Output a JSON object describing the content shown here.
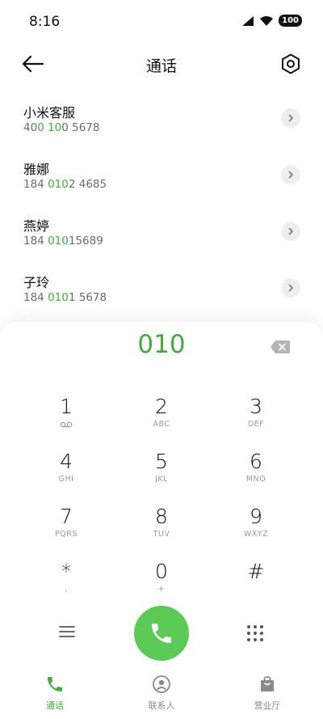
{
  "status": {
    "time": "8:16",
    "battery": "100"
  },
  "header": {
    "title": "通话"
  },
  "contacts": [
    {
      "name": "小米客服",
      "number_pre": "40",
      "number_hl": "0 10",
      "number_post": "0 5678"
    },
    {
      "name": "雅娜",
      "number_pre": "184 ",
      "number_hl": "010",
      "number_post": "2 4685"
    },
    {
      "name": "燕婷",
      "number_pre": "184 ",
      "number_hl": "010",
      "number_post": "15689"
    },
    {
      "name": "子玲",
      "number_pre": "184 ",
      "number_hl": "010",
      "number_post": "1 5678"
    }
  ],
  "dialer": {
    "input": "010",
    "keys": [
      {
        "digit": "1",
        "letters": ""
      },
      {
        "digit": "2",
        "letters": "ABC"
      },
      {
        "digit": "3",
        "letters": "DEF"
      },
      {
        "digit": "4",
        "letters": "GHI"
      },
      {
        "digit": "5",
        "letters": "JKL"
      },
      {
        "digit": "6",
        "letters": "MNO"
      },
      {
        "digit": "7",
        "letters": "PQRS"
      },
      {
        "digit": "8",
        "letters": "TUV"
      },
      {
        "digit": "9",
        "letters": "WXYZ"
      },
      {
        "digit": "*",
        "letters": ","
      },
      {
        "digit": "0",
        "letters": "+"
      },
      {
        "digit": "#",
        "letters": ""
      }
    ]
  },
  "tabs": [
    {
      "label": "通话",
      "icon": "phone-icon",
      "active": true
    },
    {
      "label": "联系人",
      "icon": "person-icon",
      "active": false
    },
    {
      "label": "营业厅",
      "icon": "bag-icon",
      "active": false
    }
  ],
  "colors": {
    "accent": "#3fae3a",
    "call_button": "#5ccb55"
  }
}
